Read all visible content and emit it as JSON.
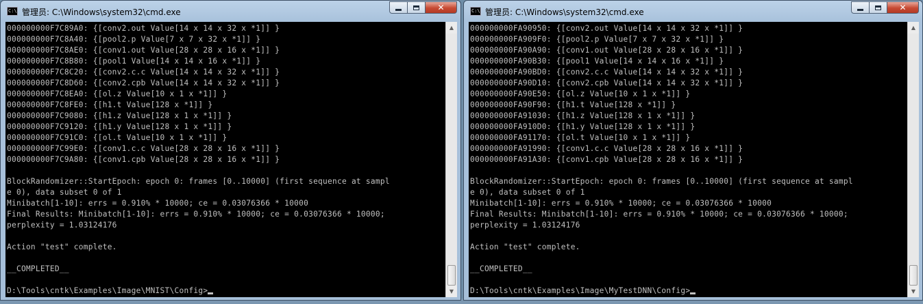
{
  "windows": [
    {
      "icon_text": "C:\\",
      "title": "管理员: C:\\Windows\\system32\\cmd.exe",
      "controls": {
        "minimize": "",
        "maximize": "",
        "close": "✕"
      },
      "console_lines": [
        "000000000F7C89A0: {[conv2.out Value[14 x 14 x 32 x *1]] }",
        "000000000F7C8A40: {[pool2.p Value[7 x 7 x 32 x *1]] }",
        "000000000F7C8AE0: {[conv1.out Value[28 x 28 x 16 x *1]] }",
        "000000000F7C8B80: {[pool1 Value[14 x 14 x 16 x *1]] }",
        "000000000F7C8C20: {[conv2.c.c Value[14 x 14 x 32 x *1]] }",
        "000000000F7C8D60: {[conv2.cpb Value[14 x 14 x 32 x *1]] }",
        "000000000F7C8EA0: {[ol.z Value[10 x 1 x *1]] }",
        "000000000F7C8FE0: {[h1.t Value[128 x *1]] }",
        "000000000F7C9080: {[h1.z Value[128 x 1 x *1]] }",
        "000000000F7C9120: {[h1.y Value[128 x 1 x *1]] }",
        "000000000F7C91C0: {[ol.t Value[10 x 1 x *1]] }",
        "000000000F7C99E0: {[conv1.c.c Value[28 x 28 x 16 x *1]] }",
        "000000000F7C9A80: {[conv1.cpb Value[28 x 28 x 16 x *1]] }",
        "",
        "BlockRandomizer::StartEpoch: epoch 0: frames [0..10000] (first sequence at sampl",
        "e 0), data subset 0 of 1",
        "Minibatch[1-10]: errs = 0.910% * 10000; ce = 0.03076366 * 10000",
        "Final Results: Minibatch[1-10]: errs = 0.910% * 10000; ce = 0.03076366 * 10000;",
        "perplexity = 1.03124176",
        "",
        "Action \"test\" complete.",
        "",
        "__COMPLETED__",
        "",
        "D:\\Tools\\cntk\\Examples\\Image\\MNIST\\Config>"
      ]
    },
    {
      "icon_text": "C:\\",
      "title": "管理员: C:\\Windows\\system32\\cmd.exe",
      "controls": {
        "minimize": "",
        "maximize": "",
        "close": "✕"
      },
      "console_lines": [
        "000000000FA90950: {[conv2.out Value[14 x 14 x 32 x *1]] }",
        "000000000FA909F0: {[pool2.p Value[7 x 7 x 32 x *1]] }",
        "000000000FA90A90: {[conv1.out Value[28 x 28 x 16 x *1]] }",
        "000000000FA90B30: {[pool1 Value[14 x 14 x 16 x *1]] }",
        "000000000FA90BD0: {[conv2.c.c Value[14 x 14 x 32 x *1]] }",
        "000000000FA90D10: {[conv2.cpb Value[14 x 14 x 32 x *1]] }",
        "000000000FA90E50: {[ol.z Value[10 x 1 x *1]] }",
        "000000000FA90F90: {[h1.t Value[128 x *1]] }",
        "000000000FA91030: {[h1.z Value[128 x 1 x *1]] }",
        "000000000FA910D0: {[h1.y Value[128 x 1 x *1]] }",
        "000000000FA91170: {[ol.t Value[10 x 1 x *1]] }",
        "000000000FA91990: {[conv1.c.c Value[28 x 28 x 16 x *1]] }",
        "000000000FA91A30: {[conv1.cpb Value[28 x 28 x 16 x *1]] }",
        "",
        "BlockRandomizer::StartEpoch: epoch 0: frames [0..10000] (first sequence at sampl",
        "e 0), data subset 0 of 1",
        "Minibatch[1-10]: errs = 0.910% * 10000; ce = 0.03076366 * 10000",
        "Final Results: Minibatch[1-10]: errs = 0.910% * 10000; ce = 0.03076366 * 10000;",
        "perplexity = 1.03124176",
        "",
        "Action \"test\" complete.",
        "",
        "__COMPLETED__",
        "",
        "D:\\Tools\\cntk\\Examples\\Image\\MyTestDNN\\Config>"
      ]
    }
  ],
  "scrollbar": {
    "up_arrow": "▲",
    "down_arrow": "▼"
  }
}
